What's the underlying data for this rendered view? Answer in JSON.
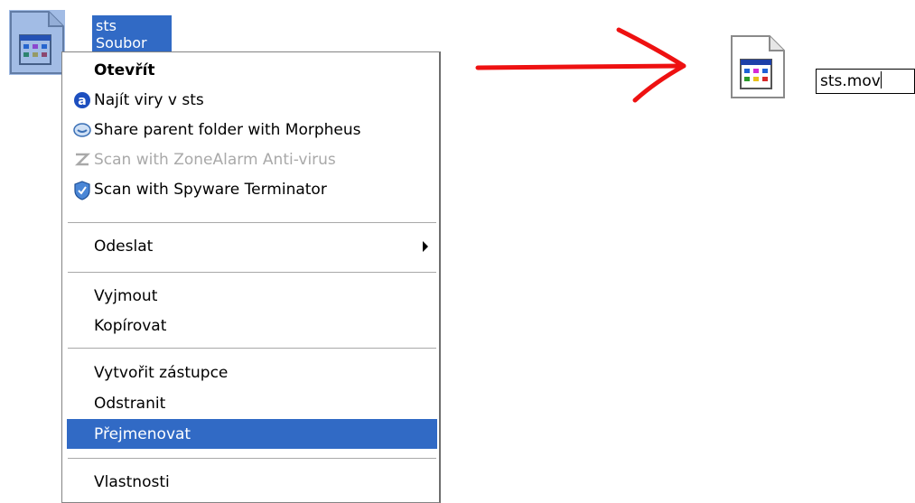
{
  "desktop": {
    "selected_file": {
      "name": "sts",
      "type_line": "Soubor"
    }
  },
  "context_menu": {
    "items": [
      {
        "label": "Otevřít",
        "style": "bold"
      },
      {
        "label": "Najít viry v sts",
        "icon": "antivirus-a-icon"
      },
      {
        "label": "Share parent folder with Morpheus",
        "icon": "morpheus-icon"
      },
      {
        "label": "Scan with ZoneAlarm Anti-virus",
        "icon": "zonealarm-icon",
        "state": "disabled"
      },
      {
        "label": "Scan with Spyware Terminator",
        "icon": "spyware-terminator-shield-icon"
      },
      {
        "label": "Odeslat",
        "has_submenu": true
      },
      {
        "label": "Vyjmout"
      },
      {
        "label": "Kopírovat"
      },
      {
        "label": "Vytvořit zástupce"
      },
      {
        "label": "Odstranit"
      },
      {
        "label": "Přejmenovat",
        "state": "highlighted"
      },
      {
        "label": "Vlastnosti"
      }
    ]
  },
  "rename": {
    "value": "sts.mov"
  },
  "colors": {
    "selection": "#316ac5",
    "arrow": "#ee1111",
    "disabled_text": "#a9a9a9"
  }
}
